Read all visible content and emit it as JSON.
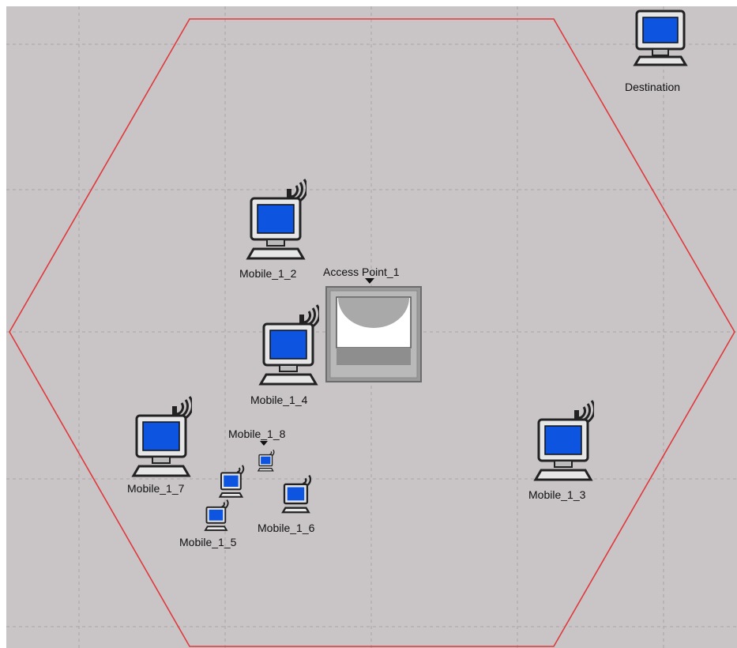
{
  "nodes": {
    "destination": {
      "label": "Destination",
      "icon": "workstation-icon"
    },
    "mobile_1_2": {
      "label": "Mobile_1_2",
      "icon": "wireless-workstation-icon"
    },
    "mobile_1_4": {
      "label": "Mobile_1_4",
      "icon": "wireless-workstation-icon"
    },
    "mobile_1_3": {
      "label": "Mobile_1_3",
      "icon": "wireless-workstation-icon"
    },
    "mobile_1_7": {
      "label": "Mobile_1_7",
      "icon": "wireless-workstation-icon"
    },
    "mobile_1_8": {
      "label": "Mobile_1_8",
      "icon": "wireless-workstation-icon"
    },
    "mobile_1_5": {
      "label": "Mobile_1_5",
      "icon": "wireless-workstation-icon"
    },
    "mobile_1_6": {
      "label": "Mobile_1_6",
      "icon": "wireless-workstation-icon"
    },
    "access_point_1": {
      "label": "Access Point_1",
      "icon": "access-point-icon"
    }
  },
  "colors": {
    "background": "#c9c5c6",
    "grid": "#a9a5a6",
    "hexagon": "#e0393d",
    "screen": "#0d55e0"
  }
}
